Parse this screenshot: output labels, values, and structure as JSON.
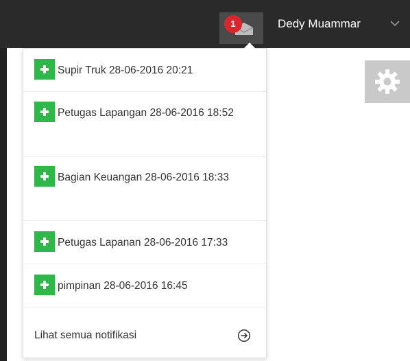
{
  "header": {
    "user_name": "Dedy Muammar",
    "notification_count": "1"
  },
  "notifications": {
    "items": [
      {
        "text": "Supir Truk 28-06-2016 20:21"
      },
      {
        "text": "Petugas Lapangan 28-06-2016 18:52"
      },
      {
        "text": "Bagian Keuangan 28-06-2016 18:33"
      },
      {
        "text": "Petugas Lapanan 28-06-2016 17:33"
      },
      {
        "text": "pimpinan 28-06-2016 16:45"
      }
    ],
    "see_all_label": "Lihat semua notifikasi"
  },
  "icons": {
    "add": "plus-icon",
    "mail": "mail-icon",
    "settings": "gear-icon",
    "user_menu": "chevron-down-icon",
    "see_all": "arrow-right-circle-icon"
  },
  "colors": {
    "topbar": "#2a2a2a",
    "badge": "#d9262c",
    "add_icon": "#2fb84a",
    "settings_box": "#c9c9c9"
  }
}
